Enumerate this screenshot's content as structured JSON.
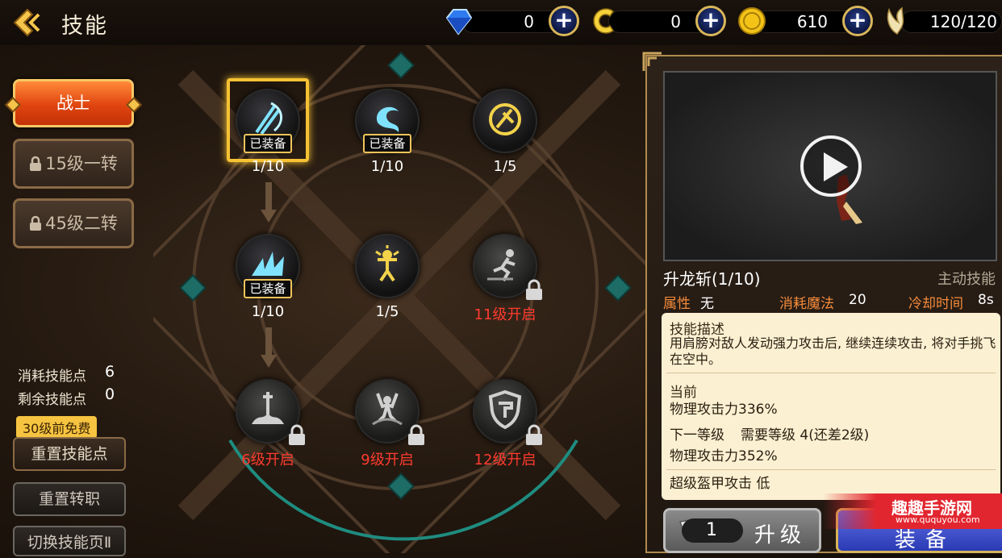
{
  "header": {
    "title": "技能",
    "resources": [
      {
        "name": "diamond",
        "value": "0",
        "color": "#2e7bf0"
      },
      {
        "name": "crescent",
        "value": "0",
        "color": "#f6d23a"
      },
      {
        "name": "gold",
        "value": "610",
        "color": "#f3c318"
      },
      {
        "name": "stamina",
        "value": "120/120",
        "color": "#f0e2b0"
      }
    ]
  },
  "sidebar": {
    "tabs": [
      {
        "label": "战士",
        "state": "active"
      },
      {
        "label": "15级一转",
        "state": "locked"
      },
      {
        "label": "45级二转",
        "state": "locked"
      }
    ],
    "stats": [
      {
        "label": "消耗技能点",
        "value": "6"
      },
      {
        "label": "剩余技能点",
        "value": "0"
      }
    ],
    "free_tag": "30级前免费",
    "buttons": {
      "reset_skill": "重置技能点",
      "reset_class": "重置转职",
      "switch_page": "切换技能页Ⅱ"
    }
  },
  "skill_tree": {
    "nodes": [
      {
        "id": "r1c1",
        "badge": "已装备",
        "level": "1/10",
        "selected": true
      },
      {
        "id": "r1c2",
        "badge": "已装备",
        "level": "1/10"
      },
      {
        "id": "r1c3",
        "badge": "",
        "level": "1/5"
      },
      {
        "id": "r2c1",
        "badge": "已装备",
        "level": "1/10"
      },
      {
        "id": "r2c2",
        "badge": "",
        "level": "1/5"
      },
      {
        "id": "r2c3",
        "badge": "",
        "level": "11级开启",
        "locked": true
      },
      {
        "id": "r3c1",
        "badge": "",
        "level": "6级开启",
        "locked": true
      },
      {
        "id": "r3c2",
        "badge": "",
        "level": "9级开启",
        "locked": true
      },
      {
        "id": "r3c3",
        "badge": "",
        "level": "12级开启",
        "locked": true
      }
    ]
  },
  "detail": {
    "skill_name": "升龙斩(1/10)",
    "skill_type": "主动技能",
    "attribute_label": "属性",
    "attribute_value": "无",
    "mp_label": "消耗魔法",
    "mp_value": "20",
    "cd_label": "冷却时间",
    "cd_value": "8s",
    "desc_title": "技能描述",
    "desc_body": "用肩膀对敌人发动强力攻击后, 继续连续攻击, 将对手挑飞在空中。",
    "current_title": "当前",
    "current_value": "物理攻击力336%",
    "next_label": "下一等级",
    "next_req": "需要等级 4(还差2级)",
    "next_value": "物理攻击力352%",
    "super_armor": "超级盔甲攻击 低",
    "upgrade_cost": "1",
    "upgrade_label": "升级",
    "equip_label": "装备"
  },
  "watermark": {
    "title": "趣趣手游网",
    "url": "www.ququyou.com"
  }
}
